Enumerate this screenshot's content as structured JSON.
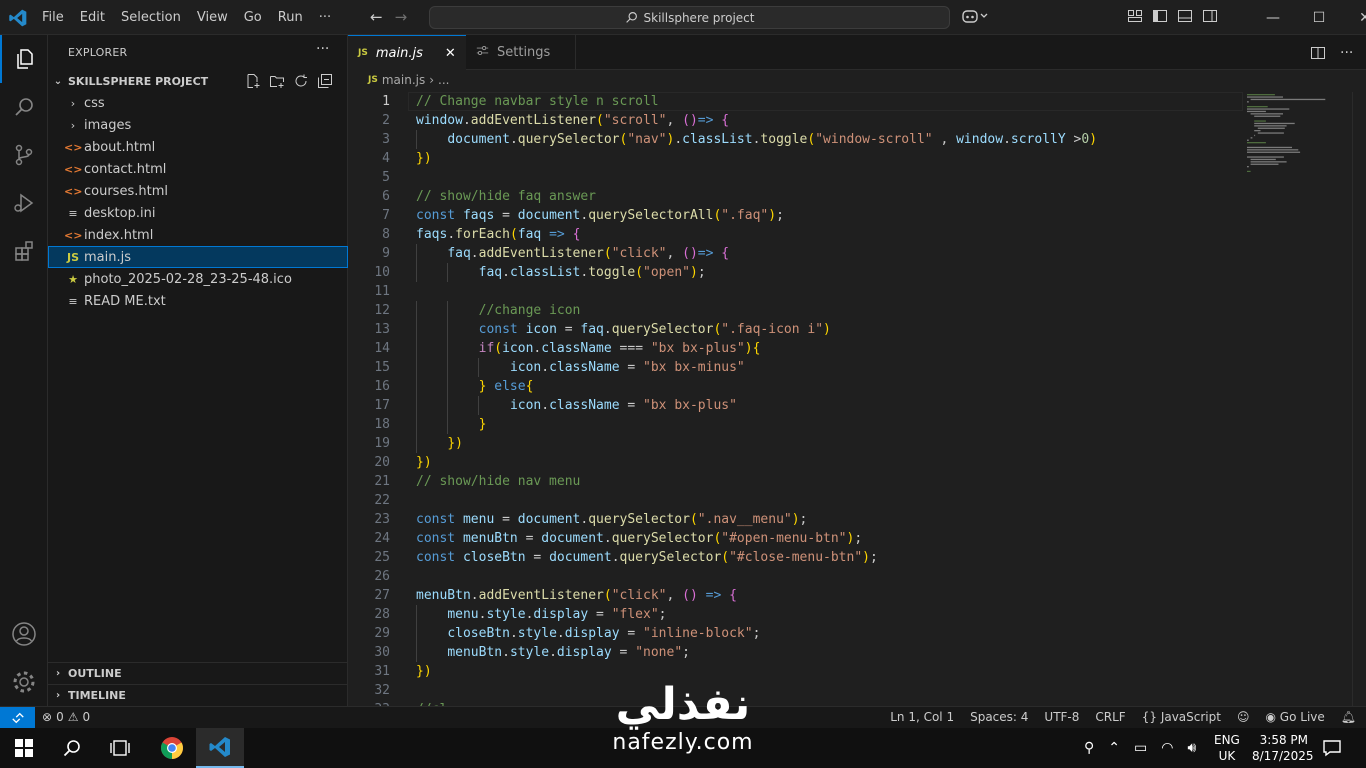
{
  "titlebar": {
    "menu": [
      "File",
      "Edit",
      "Selection",
      "View",
      "Go",
      "Run",
      "···"
    ],
    "search_text": "Skillsphere project",
    "window_controls": [
      "—",
      "☐",
      "✕"
    ]
  },
  "sidebar": {
    "title": "EXPLORER",
    "more": "···",
    "project_name": "SKILLSPHERE PROJECT",
    "items": [
      {
        "label": "css",
        "kind": "folder"
      },
      {
        "label": "images",
        "kind": "folder"
      },
      {
        "label": "about.html",
        "kind": "html"
      },
      {
        "label": "contact.html",
        "kind": "html"
      },
      {
        "label": "courses.html",
        "kind": "html"
      },
      {
        "label": "desktop.ini",
        "kind": "ini"
      },
      {
        "label": "index.html",
        "kind": "html"
      },
      {
        "label": "main.js",
        "kind": "js",
        "selected": true
      },
      {
        "label": "photo_2025-02-28_23-25-48.ico",
        "kind": "ico"
      },
      {
        "label": "READ ME.txt",
        "kind": "txt"
      }
    ],
    "outline_label": "OUTLINE",
    "timeline_label": "TIMELINE"
  },
  "editor": {
    "tabs": [
      {
        "label": "main.js",
        "icon": "JS",
        "active": true
      },
      {
        "label": "Settings",
        "icon": "settings-icon",
        "active": false
      }
    ],
    "breadcrumb": {
      "file": "main.js",
      "rest": "..."
    },
    "current_line": 1,
    "lines": [
      "// Change navbar style n scroll",
      "window.addEventListener(\"scroll\", ()=> {",
      "    document.querySelector(\"nav\").classList.toggle(\"window-scroll\" , window.scrollY >0)",
      "})",
      "",
      "// show/hide faq answer",
      "const faqs = document.querySelectorAll(\".faq\");",
      "faqs.forEach(faq => {",
      "    faq.addEventListener(\"click\", ()=> {",
      "        faq.classList.toggle(\"open\");",
      "",
      "        //change icon",
      "        const icon = faq.querySelector(\".faq-icon i\")",
      "        if(icon.className === \"bx bx-plus\"){",
      "            icon.className = \"bx bx-minus\"",
      "        } else{",
      "            icon.className = \"bx bx-plus\"",
      "        }",
      "    })",
      "})",
      "// show/hide nav menu",
      "",
      "const menu = document.querySelector(\".nav__menu\");",
      "const menuBtn = document.querySelector(\"#open-menu-btn\");",
      "const closeBtn = document.querySelector(\"#close-menu-btn\");",
      "",
      "menuBtn.addEventListener(\"click\", () => {",
      "    menu.style.display = \"flex\";",
      "    closeBtn.style.display = \"inline-block\";",
      "    menuBtn.style.display = \"none\";",
      "})",
      "",
      "//cl"
    ]
  },
  "statusbar": {
    "errors": "0",
    "warnings": "0",
    "position": "Ln 1, Col 1",
    "spaces": "Spaces: 4",
    "encoding": "UTF-8",
    "eol": "CRLF",
    "language": "JavaScript",
    "live": "Go Live"
  },
  "taskbar": {
    "lang_top": "ENG",
    "lang_bottom": "UK",
    "time": "3:58 PM",
    "date": "8/17/2025"
  },
  "watermark": {
    "arabic": "نفذلي",
    "latin": "nafezly.com"
  },
  "colors": {
    "accent": "#0078d4",
    "background": "#1f1f1f",
    "sidebar": "#181818"
  }
}
